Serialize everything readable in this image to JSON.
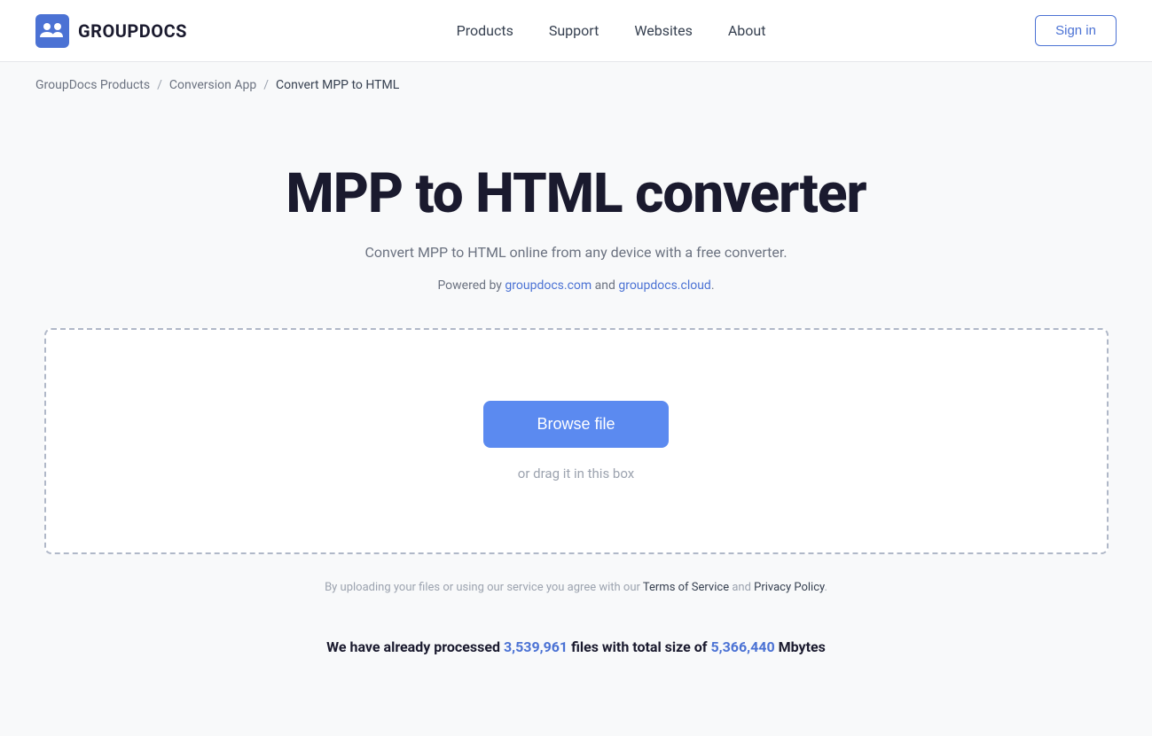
{
  "header": {
    "logo_text": "GROUPDOCS",
    "nav": {
      "items": [
        "Products",
        "Support",
        "Websites",
        "About"
      ],
      "sign_in_label": "Sign in"
    }
  },
  "breadcrumb": {
    "items": [
      {
        "label": "GroupDocs Products",
        "href": "#"
      },
      {
        "label": "Conversion App",
        "href": "#"
      },
      {
        "label": "Convert MPP to HTML"
      }
    ]
  },
  "main": {
    "title": "MPP to HTML converter",
    "subtitle": "Convert MPP to HTML online from any device with a free converter.",
    "powered_by_prefix": "Powered by ",
    "powered_by_link1_text": "groupdocs.com",
    "powered_by_between": " and ",
    "powered_by_link2_text": "groupdocs.cloud",
    "powered_by_suffix": ".",
    "drop_zone": {
      "browse_label": "Browse file",
      "drag_text": "or drag it in this box"
    },
    "terms": {
      "prefix": "By uploading your files or using our service you agree with our ",
      "link1": "Terms of Service",
      "between": " and ",
      "link2": "Privacy Policy",
      "suffix": "."
    },
    "stats": {
      "prefix": "We have already processed ",
      "files_count": "3,539,961",
      "middle": " files with total size of ",
      "size_value": "5,366,440",
      "suffix": " Mbytes"
    }
  }
}
